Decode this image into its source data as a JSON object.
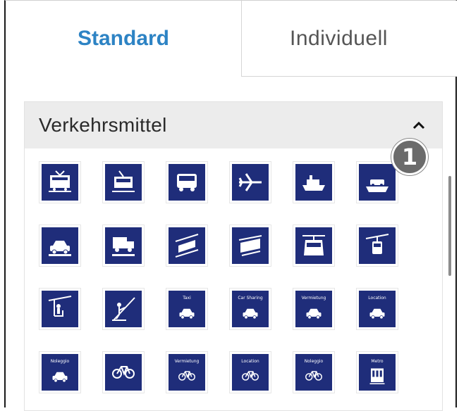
{
  "tabs": [
    {
      "label": "Standard",
      "active": true
    },
    {
      "label": "Individuell",
      "active": false
    }
  ],
  "section": {
    "title": "Verkehrsmittel",
    "expanded": true,
    "badge": "1"
  },
  "colors": {
    "accent": "#2d83c4",
    "sign_blue": "#1f2d7a",
    "header_bg": "#ececec"
  },
  "icons": [
    {
      "icon": "train-icon",
      "caption": ""
    },
    {
      "icon": "tram-icon",
      "caption": ""
    },
    {
      "icon": "bus-icon",
      "caption": ""
    },
    {
      "icon": "airplane-icon",
      "caption": ""
    },
    {
      "icon": "ship-icon",
      "caption": ""
    },
    {
      "icon": "car-ferry-icon",
      "caption": ""
    },
    {
      "icon": "car-train-icon",
      "caption": ""
    },
    {
      "icon": "truck-train-icon",
      "caption": ""
    },
    {
      "icon": "funicular-icon",
      "caption": ""
    },
    {
      "icon": "cable-railway-icon",
      "caption": ""
    },
    {
      "icon": "gondola-icon",
      "caption": ""
    },
    {
      "icon": "cable-car-icon",
      "caption": ""
    },
    {
      "icon": "chairlift-icon",
      "caption": ""
    },
    {
      "icon": "ski-lift-icon",
      "caption": ""
    },
    {
      "icon": "taxi-icon",
      "caption": "Taxi"
    },
    {
      "icon": "car-sharing-icon",
      "caption": "Car Sharing"
    },
    {
      "icon": "car-rental-icon",
      "caption": "Vermietung"
    },
    {
      "icon": "car-location-icon",
      "caption": "Location"
    },
    {
      "icon": "car-noleggio-icon",
      "caption": "Noleggio"
    },
    {
      "icon": "bike-icon",
      "caption": ""
    },
    {
      "icon": "bike-rental-icon",
      "caption": "Vermietung"
    },
    {
      "icon": "bike-location-icon",
      "caption": "Location"
    },
    {
      "icon": "bike-noleggio-icon",
      "caption": "Noleggio"
    },
    {
      "icon": "metro-icon",
      "caption": "Metro"
    }
  ]
}
